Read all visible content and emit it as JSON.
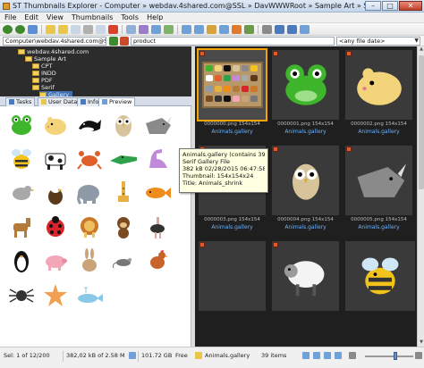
{
  "window": {
    "title": "ST Thumbnails Explorer - Computer » webdav.4shared.com@SSL » DavWWWRoot » Sample Art » Serif » Gallery",
    "minimize": "–",
    "maximize": "□",
    "close": "✕"
  },
  "menu": [
    "File",
    "Edit",
    "View",
    "Thumbnails",
    "Tools",
    "Help"
  ],
  "address": {
    "path": "Computer\\webdav.4shared.com@SSL\\DavWW",
    "filter": "product",
    "file_filter": "<any file date>"
  },
  "tree": [
    {
      "label": "webdav.4shared.com",
      "selected": false
    },
    {
      "label": "Sample Art",
      "selected": false
    },
    {
      "label": "CPT",
      "selected": false
    },
    {
      "label": "INDD",
      "selected": false
    },
    {
      "label": "PDF",
      "selected": false
    },
    {
      "label": "Serif",
      "selected": false
    },
    {
      "label": "Gallery",
      "selected": true
    }
  ],
  "panel_tabs": [
    "Tasks",
    "User Data",
    "Info",
    "Preview"
  ],
  "preview_icons": [
    "frog-icon",
    "hamster-icon",
    "whale-icon",
    "owl-icon",
    "rhino-icon",
    "bee-icon",
    "cow-icon",
    "crab-icon",
    "crocodile-icon",
    "dinosaur-icon",
    "bird-icon",
    "eagle-icon",
    "elephant-icon",
    "giraffe-icon",
    "fish-icon",
    "horse-icon",
    "ladybug-icon",
    "lion-icon",
    "monkey-icon",
    "ostrich-icon",
    "penguin-icon",
    "pig-icon",
    "rabbit-icon",
    "mouse-icon",
    "rooster-icon",
    "spider-icon",
    "starfish-icon",
    "blue-whale-icon",
    "",
    ""
  ],
  "tooltip": {
    "line1": "Animals.gallery (contains 39 images)",
    "line2": "Serif Gallery File",
    "line3": "382 kB  02/28/2015 06:47:58  Attr: A",
    "line4": "Thumbnail: 154x154x24",
    "line5": "Title: Animals_shrink"
  },
  "tiles": [
    {
      "file": "0000000.png 154x154",
      "gallery": "Animals.gallery",
      "icon": "gallery-icon",
      "selected": true
    },
    {
      "file": "0000001.png 154x154",
      "gallery": "Animals.gallery",
      "icon": "frog-icon",
      "selected": false
    },
    {
      "file": "0000002.png 154x154",
      "gallery": "Animals.gallery",
      "icon": "hamster-icon",
      "selected": false
    },
    {
      "file": "0000003.png 154x154",
      "gallery": "Animals.gallery",
      "icon": "",
      "selected": false
    },
    {
      "file": "0000004.png 154x154",
      "gallery": "Animals.gallery",
      "icon": "owl-icon",
      "selected": false
    },
    {
      "file": "0000005.png 154x154",
      "gallery": "Animals.gallery",
      "icon": "rhino-icon",
      "selected": false
    },
    {
      "file": "",
      "gallery": "",
      "icon": "",
      "selected": false
    },
    {
      "file": "",
      "gallery": "",
      "icon": "sheep-icon",
      "selected": false
    },
    {
      "file": "",
      "gallery": "",
      "icon": "bird-icon",
      "selected": false
    },
    {
      "file": "",
      "gallery": "",
      "icon": "bee-icon",
      "selected": false
    }
  ],
  "status": {
    "selection": "Sel: 1 of 12/200",
    "size": "382,02 kB of 2.58 M",
    "free": "101.72 GB",
    "free_label": "Free",
    "gallery": "Animals.gallery",
    "items": "39 items"
  },
  "colors": {
    "accent": "#3f6fb3",
    "grid_bg": "#1f1f1f",
    "selection": "#f2a400",
    "tooltip_bg": "#ffffe1",
    "link": "#6bb4ff"
  }
}
